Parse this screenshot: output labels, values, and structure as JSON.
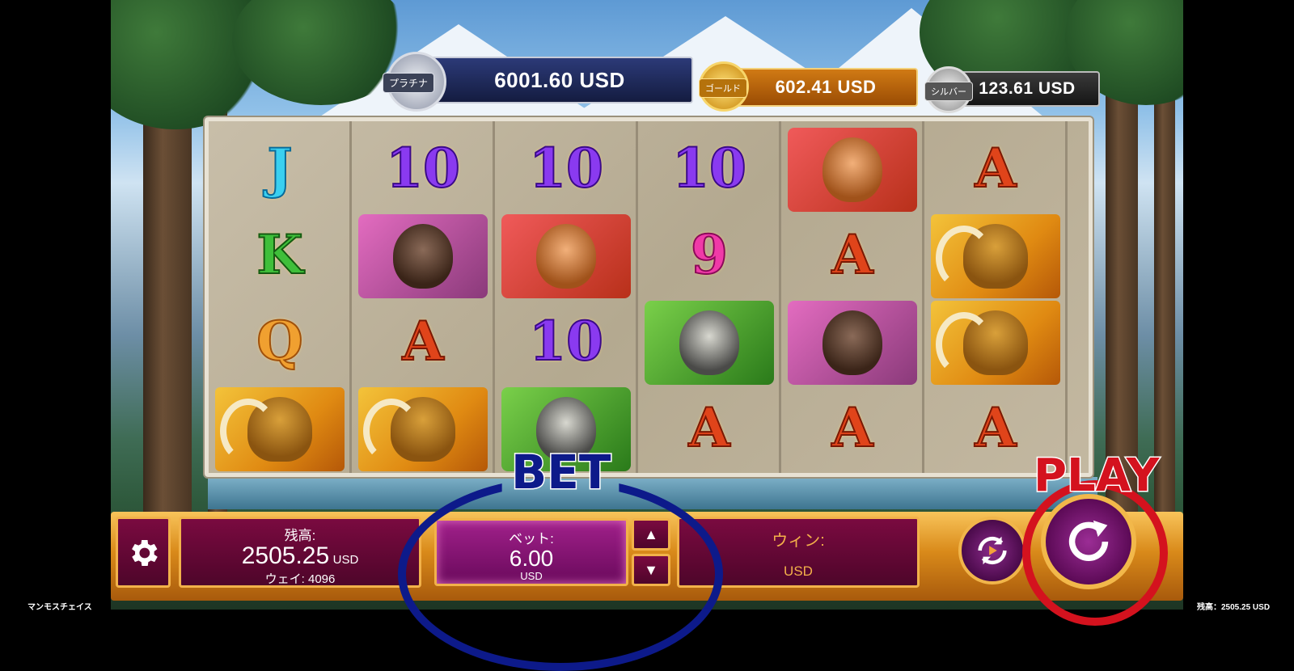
{
  "game": {
    "title": "マンモスチェイス",
    "footer_balance": "残高：2505.25 USD"
  },
  "jackpots": [
    {
      "tier": "プラチナ",
      "value": "6001.60 USD",
      "color": "#1b2552"
    },
    {
      "tier": "ゴールド",
      "value": "602.41 USD",
      "color": "#b8620a"
    },
    {
      "tier": "シルバー",
      "value": "123.61 USD",
      "color": "#2c2c2c"
    }
  ],
  "reels": [
    [
      "J",
      "K",
      "Q",
      "mammoth"
    ],
    [
      "10",
      "moose",
      "A",
      "mammoth"
    ],
    [
      "10",
      "sabertooth",
      "10",
      "wolf"
    ],
    [
      "10",
      "9",
      "wolf",
      "A"
    ],
    [
      "sabertooth",
      "A",
      "moose",
      "A"
    ],
    [
      "A",
      "mammoth",
      "mammoth",
      "A"
    ]
  ],
  "bar": {
    "balance_label": "残高:",
    "balance_value": "2505.25",
    "balance_currency": "USD",
    "ways_label": "ウェイ: 4096",
    "bet_label": "ベット:",
    "bet_value": "6.00",
    "bet_currency": "USD",
    "win_label": "ウィン:",
    "win_currency": "USD"
  },
  "overlays": {
    "bet": "BET",
    "play": "PLAY"
  },
  "icons": {
    "settings": "gear-icon",
    "autoplay": "autoplay-icon",
    "spin": "spin-icon",
    "up": "arrow-up-icon",
    "down": "arrow-down-icon"
  },
  "colors": {
    "panel": "#5e0833",
    "bar_gold": "#d98a1a",
    "bet_overlay": "#0d1a8a",
    "play_overlay": "#d4121e"
  }
}
